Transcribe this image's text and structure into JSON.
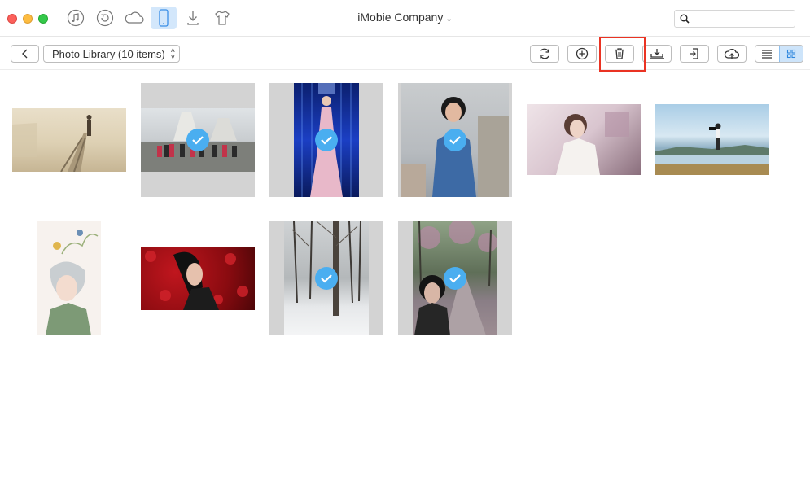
{
  "window": {
    "device_name": "iMobie Company",
    "nav_icons": [
      "music-icon",
      "backup-icon",
      "cloud-icon",
      "phone-icon",
      "download-icon",
      "shirt-icon"
    ]
  },
  "toolbar": {
    "album_label": "Photo Library (10 items)",
    "actions": [
      "refresh-icon",
      "add-icon",
      "delete-icon",
      "to-computer-icon",
      "to-device-icon",
      "to-cloud-icon"
    ],
    "view_modes": [
      "list-view-icon",
      "grid-view-icon"
    ],
    "active_view": "grid"
  },
  "photos": [
    {
      "name": "photo-1",
      "selected": false,
      "orientation": "landscape"
    },
    {
      "name": "photo-2",
      "selected": true,
      "orientation": "landscape"
    },
    {
      "name": "photo-3",
      "selected": true,
      "orientation": "portrait"
    },
    {
      "name": "photo-4",
      "selected": true,
      "orientation": "portrait"
    },
    {
      "name": "photo-5",
      "selected": false,
      "orientation": "landscape"
    },
    {
      "name": "photo-6",
      "selected": false,
      "orientation": "landscape"
    },
    {
      "name": "photo-7",
      "selected": false,
      "orientation": "portrait"
    },
    {
      "name": "photo-8",
      "selected": false,
      "orientation": "landscape"
    },
    {
      "name": "photo-9",
      "selected": true,
      "orientation": "portrait"
    },
    {
      "name": "photo-10",
      "selected": true,
      "orientation": "portrait"
    }
  ],
  "colors": {
    "accent": "#4aaef0",
    "highlight": "#ea3323",
    "selection_bg": "#d3d3d3"
  }
}
